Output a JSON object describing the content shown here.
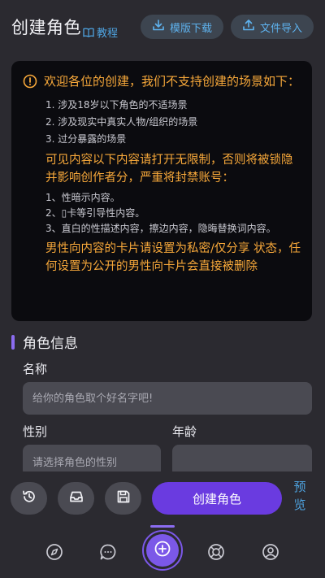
{
  "header": {
    "title": "创建角色",
    "tutorial_label": "教程",
    "download_label": "模版下载",
    "import_label": "文件导入"
  },
  "notice": {
    "intro": "欢迎各位的创建，我们不支持创建的场景如下：",
    "items": [
      "1. 涉及18岁以下角色的不适场景",
      "2. 涉及现实中真实人物/组织的场景",
      "3. 过分暴露的场景"
    ],
    "warning": "可见内容以下内容请打开无限制，否则将被锁隐并影响创作者分，严重将封禁账号：",
    "items2": [
      "1、性暗示内容。",
      "2、▯卡等引导性内容。",
      "3、直白的性描述内容，擦边内容，隐晦替换词内容。"
    ],
    "male_card_note": "男性向内容的卡片请设置为私密/仅分享 状态，任何设置为公开的男性向卡片会直接被删除"
  },
  "section": {
    "title": "角色信息"
  },
  "form": {
    "name_label": "名称",
    "name_placeholder": "给你的角色取个好名字吧!",
    "gender_label": "性别",
    "gender_placeholder": "请选择角色的性别",
    "age_label": "年龄"
  },
  "toolbar": {
    "history_icon": "history-icon",
    "inbox_icon": "inbox-icon",
    "save_icon": "save-icon",
    "create_label": "创建角色",
    "preview_label": "预览"
  },
  "nav": {
    "items": [
      "compass-icon",
      "chat-icon",
      "add-icon",
      "lifebuoy-icon",
      "profile-icon"
    ]
  },
  "colors": {
    "background": "#2b2a30",
    "accent": "#6a3be0",
    "warning": "#f7a83a",
    "link": "#4ea3e0"
  }
}
